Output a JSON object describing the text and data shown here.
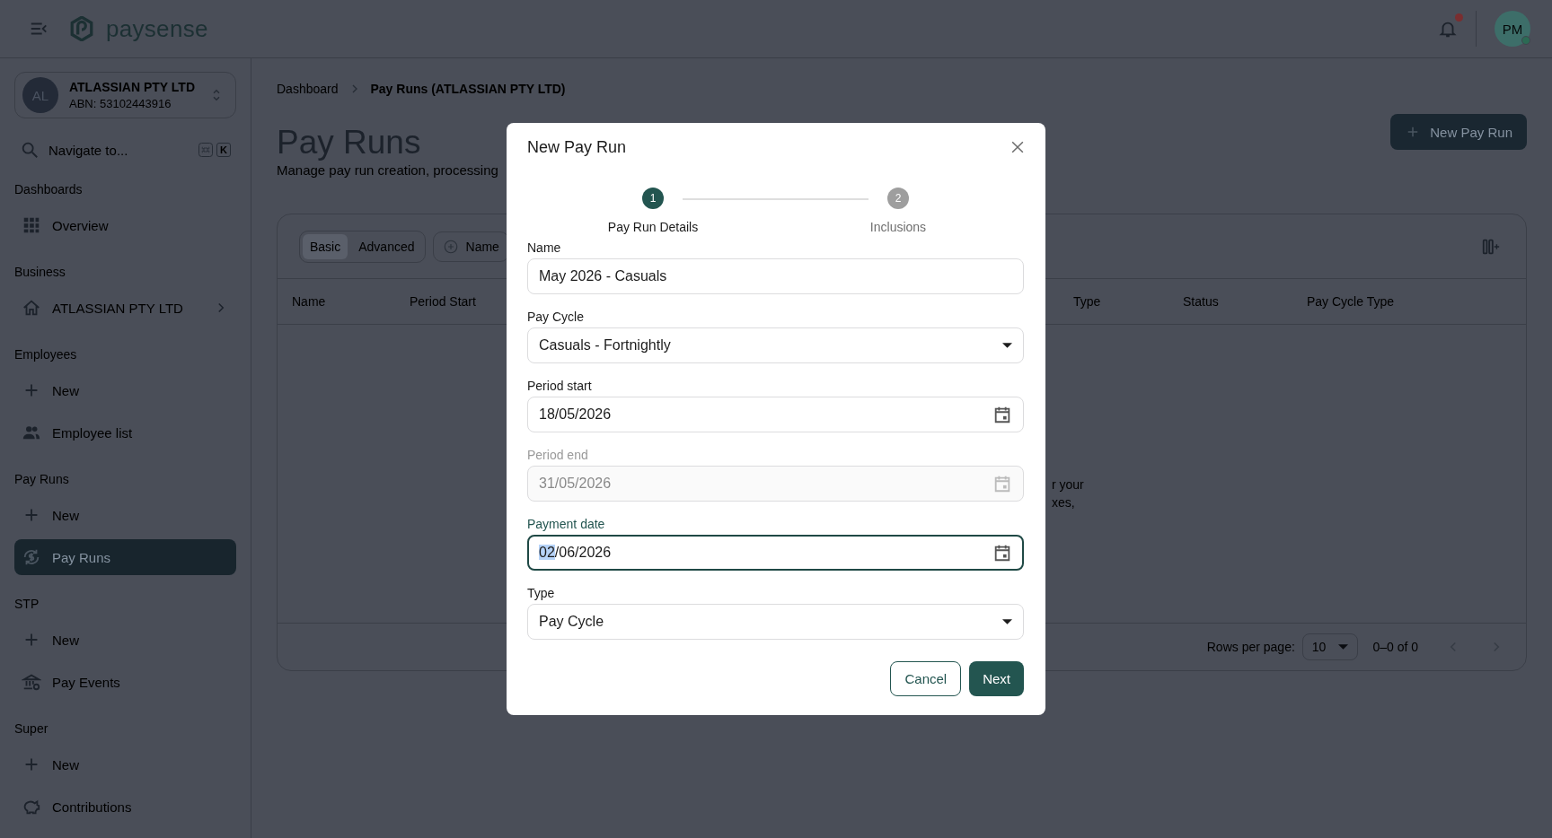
{
  "header": {
    "brand": "paysense",
    "user_initials": "PM",
    "has_unread": true,
    "online": true
  },
  "org_switcher": {
    "initials": "AL",
    "name": "ATLASSIAN PTY LTD",
    "abn": "ABN: 53102443916"
  },
  "navigate": {
    "placeholder": "Navigate to...",
    "shortcut_key": "K"
  },
  "sidebar": {
    "sections": [
      {
        "title": "Dashboards",
        "items": [
          {
            "label": "Overview",
            "selected": false,
            "has_submenu": false
          }
        ]
      },
      {
        "title": "Business",
        "items": [
          {
            "label": "ATLASSIAN PTY LTD",
            "selected": false,
            "has_submenu": true
          }
        ]
      },
      {
        "title": "Employees",
        "items": [
          {
            "label": "New",
            "selected": false,
            "has_submenu": false
          },
          {
            "label": "Employee list",
            "selected": false,
            "has_submenu": false
          }
        ]
      },
      {
        "title": "Pay Runs",
        "items": [
          {
            "label": "New",
            "selected": false,
            "has_submenu": false
          },
          {
            "label": "Pay Runs",
            "selected": true,
            "has_submenu": false
          }
        ]
      },
      {
        "title": "STP",
        "items": [
          {
            "label": "New",
            "selected": false,
            "has_submenu": false
          },
          {
            "label": "Pay Events",
            "selected": false,
            "has_submenu": false
          }
        ]
      },
      {
        "title": "Super",
        "items": [
          {
            "label": "New",
            "selected": false,
            "has_submenu": false
          },
          {
            "label": "Contributions",
            "selected": false,
            "has_submenu": false
          }
        ]
      }
    ]
  },
  "breadcrumb": [
    "Dashboard",
    "Pay Runs (ATLASSIAN PTY LTD)"
  ],
  "page": {
    "title": "Pay Runs",
    "subtitle": "Manage pay run creation, processing",
    "new_button": "New Pay Run"
  },
  "view_toggle": [
    {
      "label": "Basic",
      "selected": true
    },
    {
      "label": "Advanced",
      "selected": false
    }
  ],
  "filter_chips": [
    "Name"
  ],
  "table": {
    "columns": [
      "Name",
      "Period Start",
      "Type",
      "Status",
      "Pay Cycle Type"
    ],
    "empty_message_fragments": [
      "r your",
      "xes,"
    ]
  },
  "pagination": {
    "rows_per_page_label": "Rows per page:",
    "rows_per_page": "10",
    "range": "0–0 of 0"
  },
  "modal": {
    "title": "New Pay Run",
    "steps": [
      {
        "number": "1",
        "label": "Pay Run Details",
        "selected": true
      },
      {
        "number": "2",
        "label": "Inclusions",
        "selected": false
      }
    ],
    "fields": [
      {
        "kind": "text",
        "label": "Name",
        "value": "May 2026 - Casuals",
        "disabled": false,
        "focused": false
      },
      {
        "kind": "select",
        "label": "Pay Cycle",
        "value": "Casuals - Fortnightly",
        "disabled": false,
        "focused": false
      },
      {
        "kind": "date",
        "label": "Period start",
        "value": "18/05/2026",
        "disabled": false,
        "focused": false
      },
      {
        "kind": "date",
        "label": "Period end",
        "value": "31/05/2026",
        "disabled": true,
        "focused": false
      },
      {
        "kind": "date",
        "label": "Payment date",
        "value_selected": "02",
        "value": "/06/2026",
        "disabled": false,
        "focused": true
      },
      {
        "kind": "select",
        "label": "Type",
        "value": "Pay Cycle",
        "disabled": false,
        "focused": false
      }
    ],
    "buttons": [
      {
        "kind": "secondary",
        "label": "Cancel"
      },
      {
        "kind": "primary",
        "label": "Next"
      }
    ]
  }
}
